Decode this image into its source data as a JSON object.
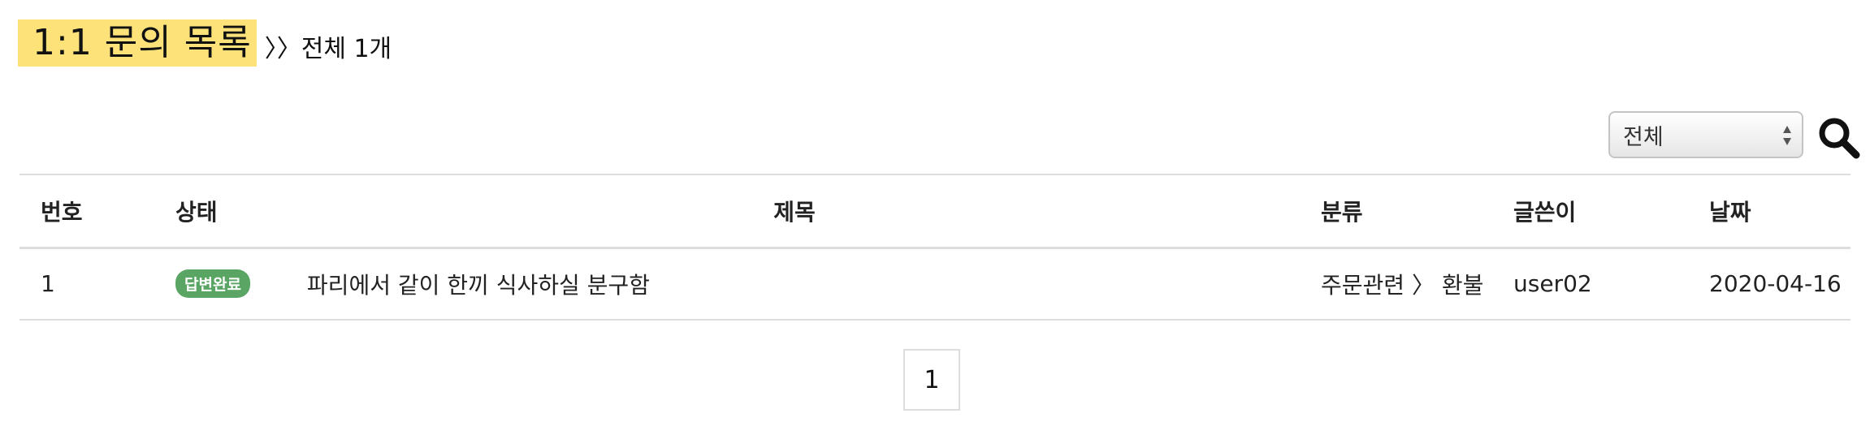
{
  "header": {
    "title": "1:1 문의 목록",
    "total": "〉〉전체 1개"
  },
  "filter": {
    "selected": "전체"
  },
  "icons": {
    "search": "search-icon",
    "select_arrows": "updown-arrows-icon"
  },
  "colors": {
    "title_highlight": "#fde27a",
    "status_badge": "#5aa564",
    "divider": "#dddddd"
  },
  "table": {
    "columns": [
      "번호",
      "상태",
      "제목",
      "분류",
      "글쓴이",
      "날짜"
    ],
    "rows": [
      {
        "number": "1",
        "status": "답변완료",
        "subject": "파리에서 같이 한끼 식사하실 분구함",
        "category": "주문관련 〉 환불",
        "author": "user02",
        "date": "2020-04-16"
      }
    ]
  },
  "pagination": {
    "current": "1"
  }
}
